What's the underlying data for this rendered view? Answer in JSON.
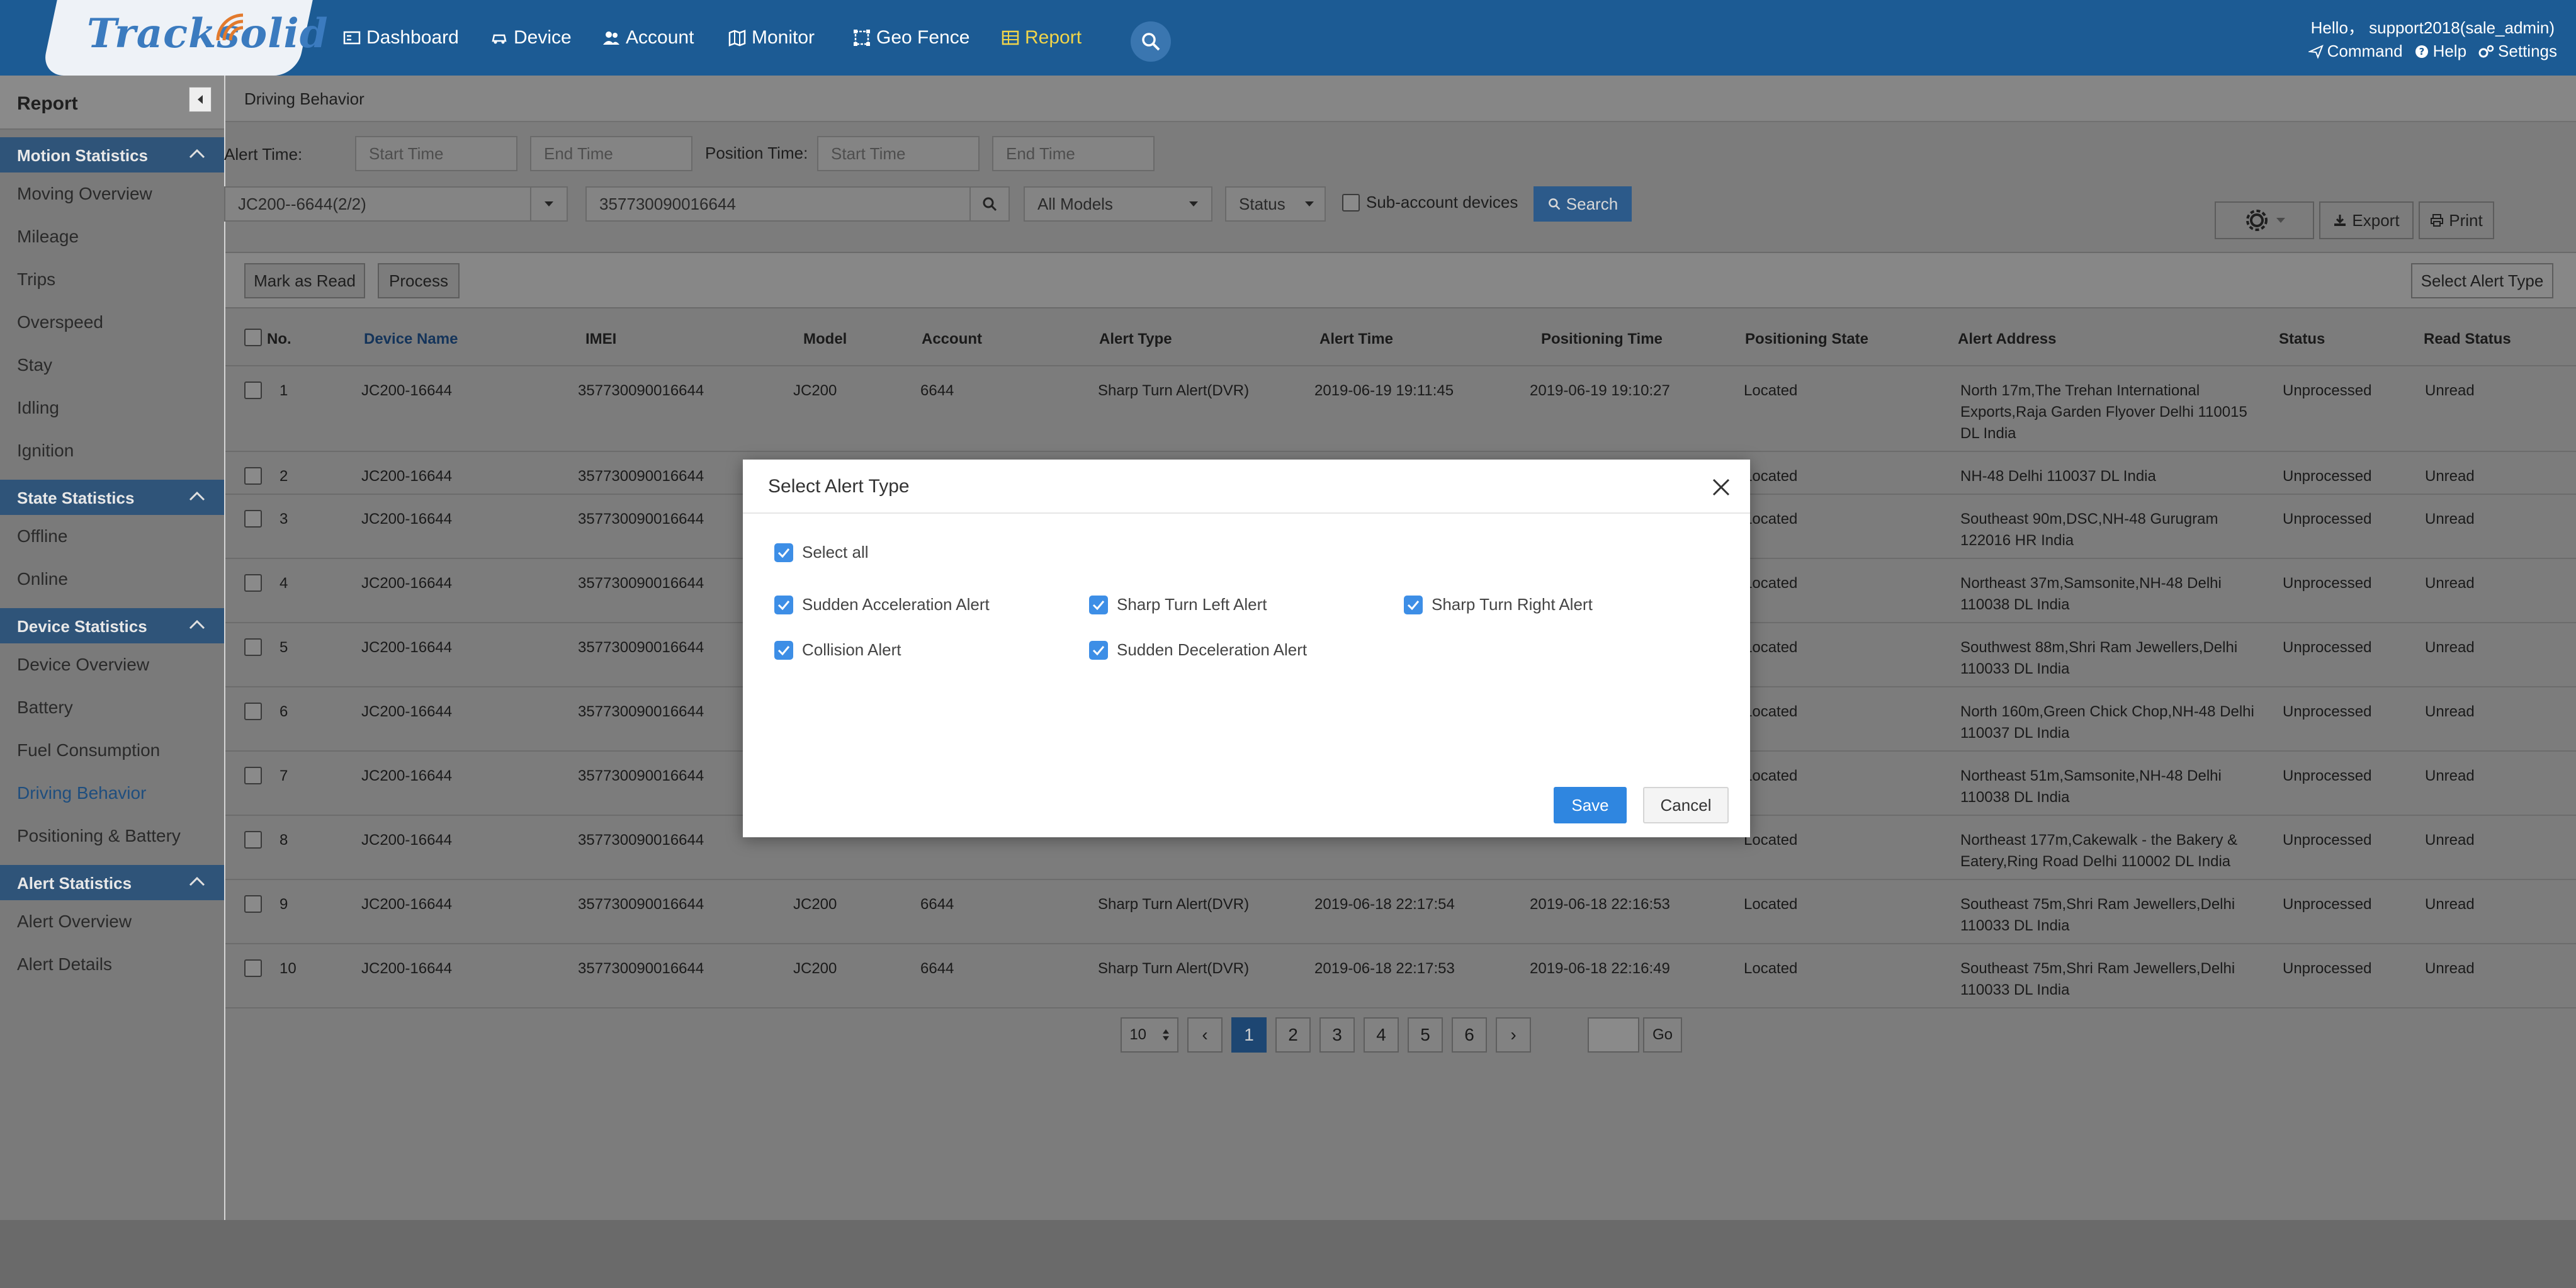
{
  "header": {
    "logo": "Tracksolid",
    "nav": [
      "Dashboard",
      "Device",
      "Account",
      "Monitor",
      "Geo Fence",
      "Report"
    ],
    "active_nav": "Report",
    "greeting": "Hello，",
    "user": "support2018(sale_admin)",
    "links": [
      "Command",
      "Help",
      "Settings"
    ]
  },
  "sidebar": {
    "title": "Report",
    "sections": [
      {
        "title": "Motion Statistics",
        "items": [
          "Moving Overview",
          "Mileage",
          "Trips",
          "Overspeed",
          "Stay",
          "Idling",
          "Ignition"
        ]
      },
      {
        "title": "State Statistics",
        "items": [
          "Offline",
          "Online"
        ]
      },
      {
        "title": "Device Statistics",
        "items": [
          "Device Overview",
          "Battery",
          "Fuel Consumption",
          "Driving Behavior",
          "Positioning & Battery"
        ]
      },
      {
        "title": "Alert Statistics",
        "items": [
          "Alert Overview",
          "Alert Details"
        ]
      }
    ],
    "active_item": "Driving Behavior"
  },
  "page": {
    "breadcrumb": "Driving Behavior",
    "filters": {
      "alert_time_label": "Alert Time:",
      "position_time_label": "Position Time:",
      "start_placeholder": "Start Time",
      "end_placeholder": "End Time",
      "account_select": "JC200--6644(2/2)",
      "imei_value": "357730090016644",
      "model_select": "All Models",
      "status_select": "Status",
      "sub_account_label": "Sub-account devices",
      "search_label": "Search",
      "export_label": "Export",
      "print_label": "Print"
    },
    "actions": {
      "mark_read": "Mark as Read",
      "process": "Process",
      "select_alert_type": "Select Alert Type"
    },
    "table": {
      "columns": [
        "No.",
        "Device Name",
        "IMEI",
        "Model",
        "Account",
        "Alert Type",
        "Alert Time",
        "Positioning Time",
        "Positioning State",
        "Alert Address",
        "Status",
        "Read Status"
      ],
      "rows": [
        {
          "no": "1",
          "device": "JC200-16644",
          "imei": "357730090016644",
          "model": "JC200",
          "account": "6644",
          "type": "Sharp Turn Alert(DVR)",
          "alert_time": "2019-06-19 19:11:45",
          "pos_time": "2019-06-19 19:10:27",
          "state": "Located",
          "address": "North 17m,The Trehan International Exports,Raja Garden Flyover Delhi 110015 DL India",
          "status": "Unprocessed",
          "read": "Unread"
        },
        {
          "no": "2",
          "device": "JC200-16644",
          "imei": "357730090016644",
          "model": "",
          "account": "",
          "type": "",
          "alert_time": "",
          "pos_time": "",
          "state": "Located",
          "address": "NH-48 Delhi 110037 DL India",
          "status": "Unprocessed",
          "read": "Unread"
        },
        {
          "no": "3",
          "device": "JC200-16644",
          "imei": "357730090016644",
          "model": "",
          "account": "",
          "type": "",
          "alert_time": "",
          "pos_time": "",
          "state": "Located",
          "address": "Southeast 90m,DSC,NH-48 Gurugram 122016 HR India",
          "status": "Unprocessed",
          "read": "Unread"
        },
        {
          "no": "4",
          "device": "JC200-16644",
          "imei": "357730090016644",
          "model": "",
          "account": "",
          "type": "",
          "alert_time": "",
          "pos_time": "",
          "state": "Located",
          "address": "Northeast 37m,Samsonite,NH-48 Delhi 110038 DL India",
          "status": "Unprocessed",
          "read": "Unread"
        },
        {
          "no": "5",
          "device": "JC200-16644",
          "imei": "357730090016644",
          "model": "",
          "account": "",
          "type": "",
          "alert_time": "",
          "pos_time": "",
          "state": "Located",
          "address": "Southwest 88m,Shri Ram Jewellers,Delhi 110033 DL India",
          "status": "Unprocessed",
          "read": "Unread"
        },
        {
          "no": "6",
          "device": "JC200-16644",
          "imei": "357730090016644",
          "model": "",
          "account": "",
          "type": "",
          "alert_time": "",
          "pos_time": "",
          "state": "Located",
          "address": "North 160m,Green Chick Chop,NH-48 Delhi 110037 DL India",
          "status": "Unprocessed",
          "read": "Unread"
        },
        {
          "no": "7",
          "device": "JC200-16644",
          "imei": "357730090016644",
          "model": "",
          "account": "",
          "type": "",
          "alert_time": "",
          "pos_time": "",
          "state": "Located",
          "address": "Northeast 51m,Samsonite,NH-48 Delhi 110038 DL India",
          "status": "Unprocessed",
          "read": "Unread"
        },
        {
          "no": "8",
          "device": "JC200-16644",
          "imei": "357730090016644",
          "model": "",
          "account": "",
          "type": "",
          "alert_time": "",
          "pos_time": "",
          "state": "Located",
          "address": "Northeast 177m,Cakewalk - the Bakery & Eatery,Ring Road Delhi 110002 DL India",
          "status": "Unprocessed",
          "read": "Unread"
        },
        {
          "no": "9",
          "device": "JC200-16644",
          "imei": "357730090016644",
          "model": "JC200",
          "account": "6644",
          "type": "Sharp Turn Alert(DVR)",
          "alert_time": "2019-06-18 22:17:54",
          "pos_time": "2019-06-18 22:16:53",
          "state": "Located",
          "address": "Southeast 75m,Shri Ram Jewellers,Delhi 110033 DL India",
          "status": "Unprocessed",
          "read": "Unread"
        },
        {
          "no": "10",
          "device": "JC200-16644",
          "imei": "357730090016644",
          "model": "JC200",
          "account": "6644",
          "type": "Sharp Turn Alert(DVR)",
          "alert_time": "2019-06-18 22:17:53",
          "pos_time": "2019-06-18 22:16:49",
          "state": "Located",
          "address": "Southeast 75m,Shri Ram Jewellers,Delhi 110033 DL India",
          "status": "Unprocessed",
          "read": "Unread"
        }
      ]
    },
    "pagination": {
      "page_size": "10",
      "pages": [
        "1",
        "2",
        "3",
        "4",
        "5",
        "6"
      ],
      "current": "1",
      "prev": "‹",
      "next": "›",
      "go_label": "Go"
    }
  },
  "modal": {
    "title": "Select Alert Type",
    "select_all": "Select all",
    "options": [
      "Sudden Acceleration Alert",
      "Sharp Turn Left Alert",
      "Sharp Turn Right Alert",
      "Collision Alert",
      "Sudden Deceleration Alert"
    ],
    "checked": [
      true,
      true,
      true,
      true,
      true
    ],
    "save_label": "Save",
    "cancel_label": "Cancel"
  },
  "colors": {
    "header_bg": "#1c5b94",
    "active_nav": "#f0d44a",
    "checkbox_blue": "#3d8ee6",
    "save_button": "#2f86e0"
  }
}
